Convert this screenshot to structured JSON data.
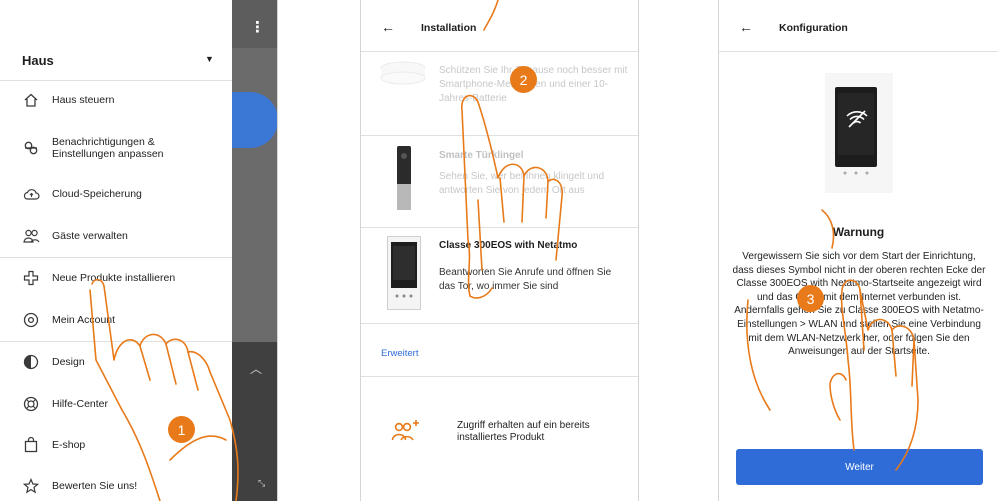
{
  "drawer": {
    "title": "Haus",
    "items": [
      {
        "icon": "house-icon",
        "label": "Haus steuern"
      },
      {
        "icon": "notification-settings-icon",
        "label": "Benachrichtigungen &\nEinstellungen anpassen"
      },
      {
        "icon": "cloud-upload-icon",
        "label": "Cloud-Speicherung"
      },
      {
        "icon": "guests-icon",
        "label": "Gäste verwalten"
      },
      {
        "icon": "plus-outline-icon",
        "label": "Neue Produkte installieren"
      },
      {
        "icon": "account-icon",
        "label": "Mein Account"
      },
      {
        "icon": "contrast-icon",
        "label": "Design"
      },
      {
        "icon": "help-icon",
        "label": "Hilfe-Center"
      },
      {
        "icon": "shopping-bag-icon",
        "label": "E-shop"
      },
      {
        "icon": "star-icon",
        "label": "Bewerten Sie uns!"
      }
    ]
  },
  "installation": {
    "title": "Installation",
    "products": [
      {
        "name": "",
        "description": "Schützen Sie Ihr Zuhause noch besser mit Smartphone-Meldungen und einer 10-Jahres-Batterie"
      },
      {
        "name": "Smarte Türklingel",
        "description": "Sehen Sie, wer bei Ihnen klingelt und antworten Sie von jedem Ort aus"
      },
      {
        "name": "Classe 300EOS with Netatmo",
        "description": "Beantworten Sie Anrufe und öffnen Sie das Tor, wo immer Sie sind"
      }
    ],
    "advanced_link": "Erweitert",
    "access_existing": "Zugriff erhalten auf ein bereits installiertes Produkt"
  },
  "configuration": {
    "title": "Konfiguration",
    "warning_title": "Warnung",
    "warning_text": "Vergewissern Sie sich vor dem Start der Einrichtung, dass dieses Symbol nicht in der oberen rechten Ecke der Classe 300EOS with Netatmo-Startseite angezeigt wird und das Gerät mit dem Internet verbunden ist. Andernfalls gehen Sie zu Classe 300EOS with Netatmo-Einstellungen > WLAN und stellen Sie eine Verbindung mit dem WLAN-Netzwerk her, oder folgen Sie den Anweisungen auf der Startseite.",
    "next_button": "Weiter"
  },
  "steps": [
    "1",
    "2",
    "3"
  ],
  "colors": {
    "accent_orange": "#e87a1a",
    "primary_blue": "#2f6cd8",
    "text_dark": "#1e1e1e"
  }
}
